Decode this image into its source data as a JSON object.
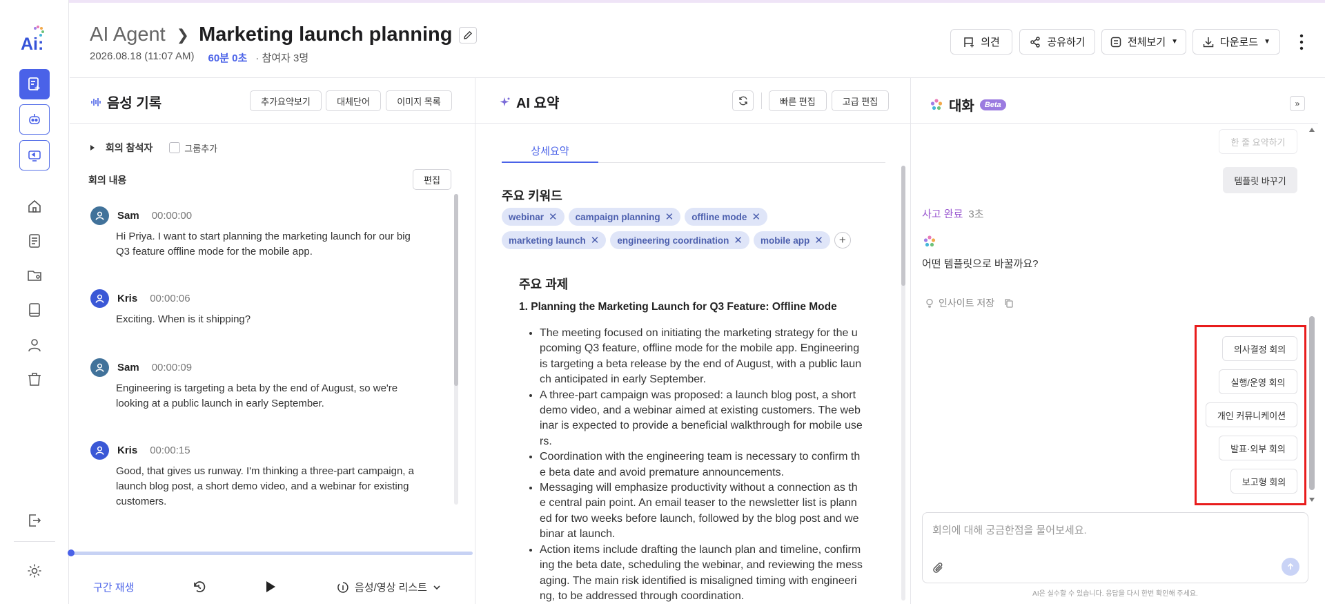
{
  "app": {
    "logo_text": "Ai:"
  },
  "header": {
    "breadcrumb_root": "AI Agent",
    "title": "Marketing launch planning",
    "date": "2026.08.18 (11:07 AM)",
    "duration": "60분 0초",
    "participants": "· 참여자 3명",
    "actions": {
      "feedback": "의견",
      "share": "공유하기",
      "view_all": "전체보기",
      "download": "다운로드"
    }
  },
  "transcript": {
    "title": "음성 기록",
    "buttons": {
      "more_summary": "추가요약보기",
      "replace_word": "대체단어",
      "image_list": "이미지 목록"
    },
    "attendees_label": "회의 참석자",
    "add_group": "그룹추가",
    "content_label": "회의 내용",
    "edit": "편집",
    "entries": [
      {
        "speaker": "Sam",
        "time": "00:00:00",
        "text": "Hi Priya. I want to start planning the marketing launch for our big Q3 feature offline mode for the mobile app."
      },
      {
        "speaker": "Kris",
        "time": "00:00:06",
        "text": "Exciting. When is it shipping?"
      },
      {
        "speaker": "Sam",
        "time": "00:00:09",
        "text": "Engineering is targeting a beta by the end of August, so we're looking at a public launch in early September."
      },
      {
        "speaker": "Kris",
        "time": "00:00:15",
        "text": "Good, that gives us runway.  I'm thinking a three-part campaign, a launch blog post, a short demo video, and a webinar  for existing customers."
      }
    ],
    "player": {
      "segment_play": "구간 재생",
      "media_list": "음성/영상 리스트",
      "progress": 0
    }
  },
  "summary": {
    "title": "AI 요약",
    "buttons": {
      "quick_edit": "빠른 편집",
      "advanced_edit": "고급 편집"
    },
    "tab": "상세요약",
    "keywords_title": "주요 키워드",
    "keywords": [
      "webinar",
      "campaign planning",
      "offline mode",
      "marketing launch",
      "engineering coordination",
      "mobile app"
    ],
    "tasks_title": "주요 과제",
    "task_heading": "1. Planning the Marketing Launch for Q3 Feature: Offline Mode",
    "bullets": [
      "The meeting focused on initiating the marketing strategy for the upcoming Q3 feature, offline mode for the mobile app. Engineering is targeting a beta release by the end of August, with a public launch anticipated in early September.",
      "A three-part campaign was proposed: a launch blog post, a short demo video, and a webinar aimed at existing customers. The webinar is expected to provide a beneficial walkthrough for mobile users.",
      "Coordination with the engineering team is necessary to confirm the beta date and avoid premature announcements.",
      "Messaging will emphasize productivity without a connection as the central pain point. An email teaser to the newsletter list is planned for two weeks before launch, followed by the blog post and webinar at launch.",
      "Action items include drafting the launch plan and timeline, confirming the beta date, scheduling the webinar, and reviewing the messaging. The main risk identified is misaligned timing with engineering, to be addressed through coordination."
    ]
  },
  "chat": {
    "title": "대화",
    "badge": "Beta",
    "one_line_summary": "한 줄 요약하기",
    "change_template": "템플릿 바꾸기",
    "thinking_done": "사고 완료",
    "thinking_time": "3초",
    "question": "어떤 템플릿으로 바꿀까요?",
    "save_insight": "인사이트 저장",
    "options": [
      "의사결정 회의",
      "실행/운영 회의",
      "개인 커뮤니케이션",
      "발표·외부 회의",
      "보고형 회의"
    ],
    "input_placeholder": "회의에 대해 궁금한점을 물어보세요.",
    "disclaimer": "AI은 실수할 수 있습니다. 응답을 다시 한번 확인해 주세요."
  },
  "colors": {
    "accent": "#4a62e8",
    "highlight": "#e81c1c",
    "chip_bg": "#dfe5f8",
    "think": "#9b59d0"
  }
}
